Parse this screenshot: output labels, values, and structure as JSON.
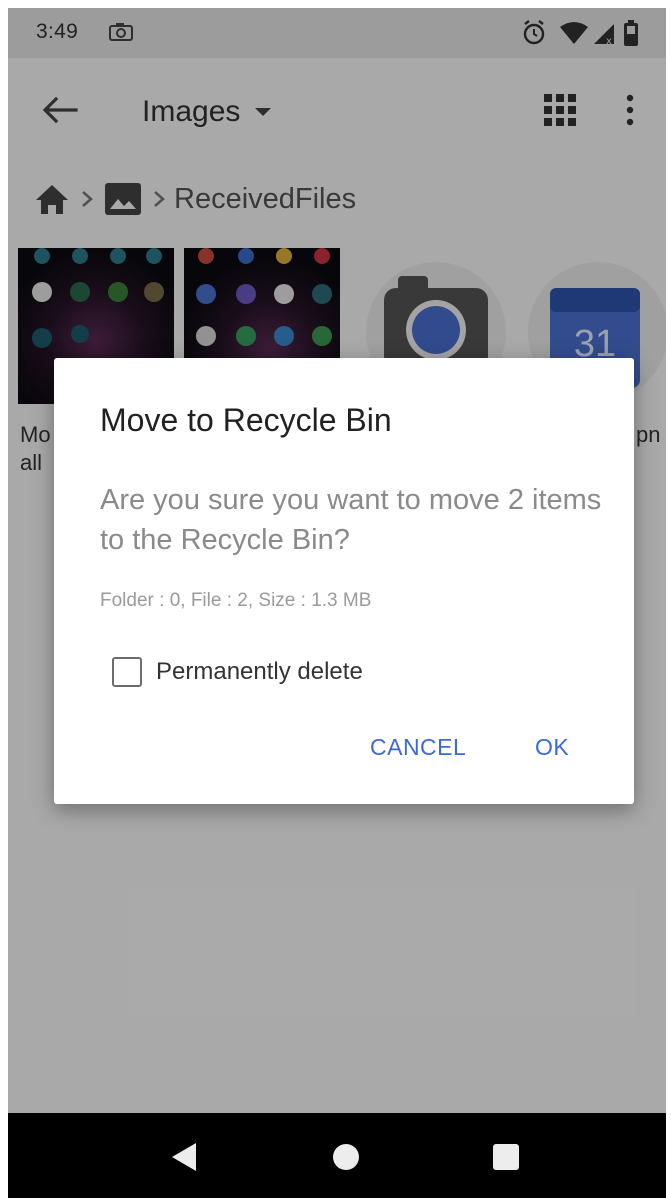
{
  "status_bar": {
    "time": "3:49",
    "icons": [
      "screenshot-icon",
      "alarm-icon",
      "wifi-icon",
      "cell-signal-icon",
      "battery-icon"
    ]
  },
  "app_bar": {
    "title": "Images",
    "icons": [
      "back-arrow-icon",
      "dropdown-caret-icon",
      "grid-view-icon",
      "more-vert-icon"
    ]
  },
  "breadcrumb": {
    "folder": "ReceivedFiles",
    "icons": [
      "home-icon",
      "chevron-right-icon",
      "image-folder-icon"
    ]
  },
  "files": {
    "partial_captions": [
      "Mo",
      "all",
      "pn"
    ],
    "icons": [
      "camera-app-icon",
      "calendar-app-icon"
    ],
    "calendar_number": "31"
  },
  "dialog": {
    "title": "Move to Recycle Bin",
    "message": "Are you sure you want to move 2 items to the Recycle Bin?",
    "info": "Folder : 0, File : 2, Size : 1.3 MB",
    "checkbox_label": "Permanently delete",
    "checkbox_checked": false,
    "cancel_label": "CANCEL",
    "ok_label": "OK"
  },
  "colors": {
    "accent": "#3b6ad8",
    "status_bar": "#e6e6e6",
    "nav_bar": "#000000"
  },
  "nav_bar": {
    "icons": [
      "nav-back-icon",
      "nav-home-icon",
      "nav-recents-icon"
    ]
  }
}
